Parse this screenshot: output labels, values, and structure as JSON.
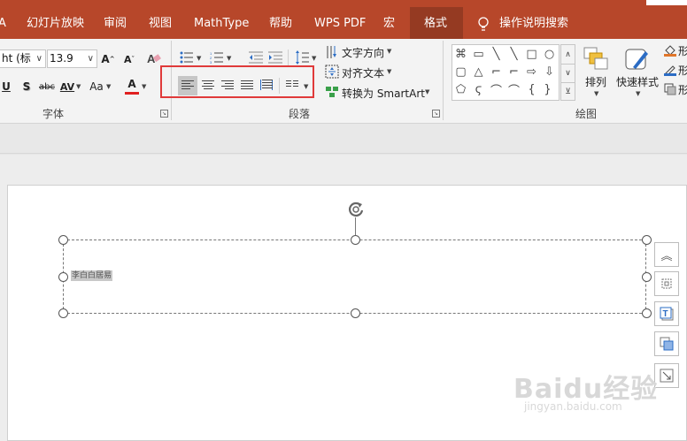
{
  "menu": {
    "items": [
      {
        "label": "A"
      },
      {
        "label": "幻灯片放映"
      },
      {
        "label": "审阅"
      },
      {
        "label": "视图"
      },
      {
        "label": "MathType"
      },
      {
        "label": "帮助"
      },
      {
        "label": "WPS PDF"
      },
      {
        "label": "宏"
      }
    ],
    "active_tab": "格式",
    "search_label": "操作说明搜索"
  },
  "font_group": {
    "font_name": "ht (标",
    "font_size": "13.9",
    "label": "字体",
    "underline": "U",
    "shadow": "S",
    "strike": "abc",
    "spacing": "AV",
    "case": "Aa",
    "color_a": "A"
  },
  "paragraph_group": {
    "label": "段落",
    "text_direction": "文字方向",
    "align_text": "对齐文本",
    "convert_smartart": "转换为 SmartArt"
  },
  "drawing_group": {
    "label": "绘图",
    "arrange": "排列",
    "quick_styles": "快速样式",
    "shape_glyphs": [
      "⌘",
      "▭",
      "╲",
      "╲",
      "□",
      "○",
      "▢",
      "△",
      "⌐",
      "⌐",
      "⇨",
      "⇩",
      "⬠",
      "ϛ",
      "⌒",
      "⌒",
      "{",
      "}",
      "☆"
    ]
  },
  "right_edge": {
    "labels": [
      "形",
      "形",
      "形"
    ]
  },
  "slide": {
    "selected_text": "李白白居易"
  },
  "watermark": {
    "text": "Baidu经验",
    "sub": "jingyan.baidu.com"
  },
  "colors": {
    "accent": "#b7472a",
    "active_tab": "#953a22",
    "highlight_box": "#e03a3a"
  }
}
